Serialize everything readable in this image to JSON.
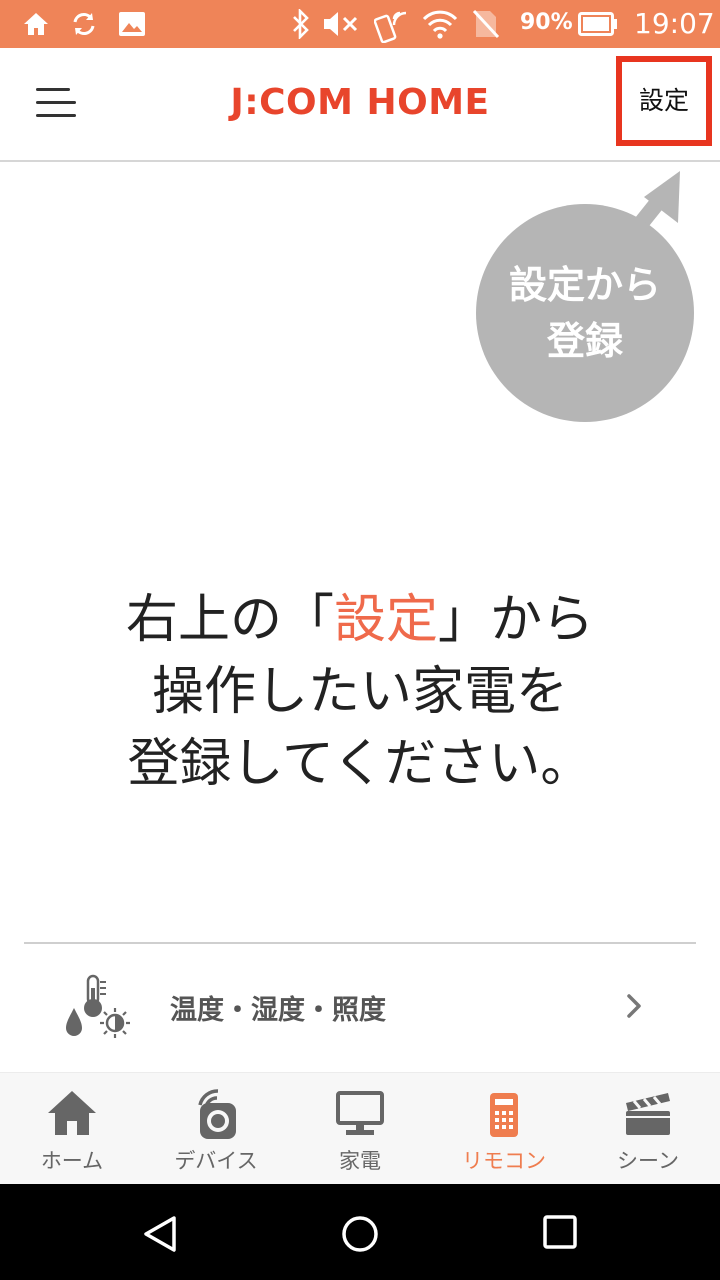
{
  "status_bar": {
    "battery_percent": "90%",
    "time": "19:07",
    "icons": [
      "home-icon",
      "sync-icon",
      "image-icon",
      "bluetooth-icon",
      "mute-icon",
      "nfc-icon",
      "wifi-icon",
      "no-sim-icon",
      "battery-icon"
    ]
  },
  "header": {
    "title": "J:COM HOME",
    "settings_label": "設定"
  },
  "hint": {
    "line1": "設定から",
    "line2": "登録"
  },
  "message": {
    "line1_pre": "右上の「",
    "line1_accent": "設定",
    "line1_post": "」から",
    "line2": "操作したい家電を",
    "line3": "登録してください。"
  },
  "env_row": {
    "label": "温度・湿度・照度"
  },
  "tabs": [
    {
      "label": "ホーム",
      "icon": "home-icon"
    },
    {
      "label": "デバイス",
      "icon": "device-icon"
    },
    {
      "label": "家電",
      "icon": "monitor-icon"
    },
    {
      "label": "リモコン",
      "icon": "remote-icon",
      "active": true
    },
    {
      "label": "シーン",
      "icon": "clapper-icon"
    }
  ],
  "colors": {
    "status_bar": "#ef8458",
    "brand": "#e8452c",
    "accent": "#ef6a4b",
    "active_tab": "#ef7d4f",
    "highlight_box": "#e8351f"
  }
}
